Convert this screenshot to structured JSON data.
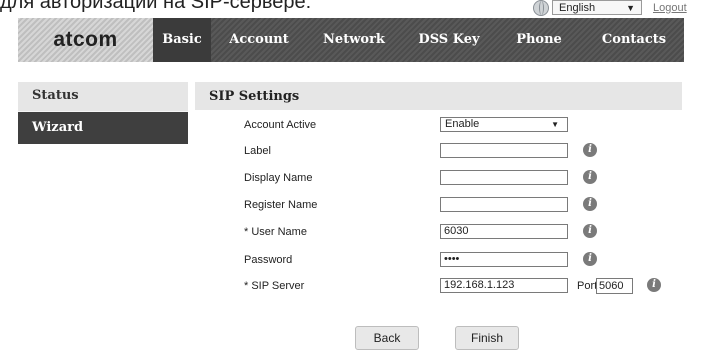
{
  "caption": "для авторизации на SIP-сервере:",
  "topbar": {
    "language": "English",
    "logout": "Logout"
  },
  "nav": {
    "logo": "atcom",
    "items": [
      "Basic",
      "Account",
      "Network",
      "DSS Key",
      "Phone",
      "Contacts"
    ],
    "active": "Basic"
  },
  "sidebar": {
    "items": [
      "Status",
      "Wizard"
    ],
    "active": "Wizard"
  },
  "section": {
    "title": "SIP Settings"
  },
  "form": {
    "account_active": {
      "label": "Account Active",
      "value": "Enable"
    },
    "label": {
      "label": "Label",
      "value": ""
    },
    "display_name": {
      "label": "Display Name",
      "value": ""
    },
    "register_name": {
      "label": "Register Name",
      "value": ""
    },
    "user_name": {
      "label": "* User Name",
      "value": "6030"
    },
    "password": {
      "label": "Password",
      "value": "••••"
    },
    "sip_server": {
      "label": "* SIP Server",
      "value": "192.168.1.123"
    },
    "port": {
      "label": "Port",
      "value": "5060"
    }
  },
  "buttons": {
    "back": "Back",
    "finish": "Finish"
  },
  "icons": {
    "info": "i"
  }
}
